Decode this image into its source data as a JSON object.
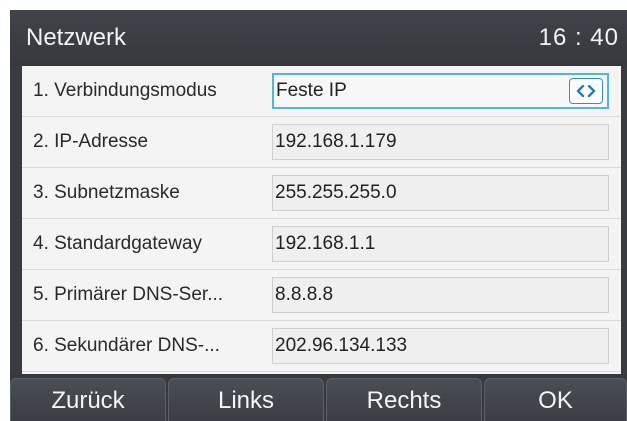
{
  "header": {
    "title": "Netzwerk",
    "time": "16 : 40"
  },
  "rows": [
    {
      "label": "1. Verbindungsmodus",
      "value": "Feste IP"
    },
    {
      "label": "2. IP-Adresse",
      "value": "192.168.1.179"
    },
    {
      "label": "3. Subnetzmaske",
      "value": "255.255.255.0"
    },
    {
      "label": "4. Standardgateway",
      "value": "192.168.1.1"
    },
    {
      "label": "5. Primärer DNS-Ser...",
      "value": "8.8.8.8"
    },
    {
      "label": "6. Sekundärer DNS-...",
      "value": "202.96.134.133"
    }
  ],
  "switch_icon": "left-right-arrows-icon",
  "softkeys": {
    "back": "Zurück",
    "left": "Links",
    "right": "Rechts",
    "ok": "OK"
  },
  "colors": {
    "accent": "#2c8fd6",
    "focus_border": "#4fb6e0",
    "header_bg": "#383b40"
  }
}
